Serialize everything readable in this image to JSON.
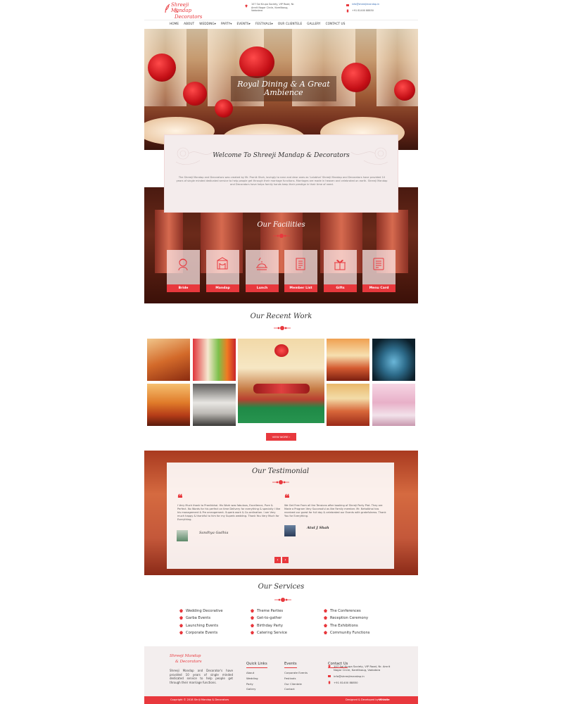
{
  "brand": {
    "name_line1": "Shreeji Mandap",
    "name_line2": "& Decorators"
  },
  "header": {
    "address": [
      "107 Sai Krupa Society, VIP Road, Nr.",
      "Amrit Nagar Circle, Karelibaug,",
      "Vadodara"
    ],
    "email": "info@shreejimandap.in",
    "phone": "+91 81400 88850"
  },
  "nav": [
    "HOME",
    "ABOUT",
    "WEDDING▾",
    "PARTY▾",
    "EVENTS▾",
    "FESTIVALS▾",
    "OUR CLIENTELE",
    "GALLERY",
    "CONTACT US"
  ],
  "hero": {
    "caption": "Royal Dining & A Great Ambience"
  },
  "welcome": {
    "title": "Welcome To Shreeji Mandap & Decorators",
    "body": "The Shreeji Mandap and Decorators was created by Mr. Pranik Shah, lovingly to near and dear ones as 'Lalubhai' Shreeji Mandap and Decorators have provided 10 years of single minded dedicated service to help people get through their marriage functions. Marriages are made in heaven and celebrated on earth. Shreeji Mandap and Decorators have helps family hands keep their prestige in their time of need."
  },
  "facilities": {
    "title": "Our Facilities",
    "items": [
      {
        "label": "Bride",
        "icon": "bride-icon"
      },
      {
        "label": "Mandap",
        "icon": "mandap-icon"
      },
      {
        "label": "Lunch",
        "icon": "lunch-icon"
      },
      {
        "label": "Member List",
        "icon": "member-list-icon"
      },
      {
        "label": "Gifts",
        "icon": "gift-icon"
      },
      {
        "label": "Menu Card",
        "icon": "menu-card-icon"
      }
    ]
  },
  "recent_work": {
    "title": "Our Recent Work",
    "button": "VIEW MORE ›"
  },
  "testimonial": {
    "title": "Our Testimonial",
    "items": [
      {
        "text": "I Very Much thank to Pranikbhai. His Work was fabulous, Excellence, Pure & Perfect. No Words for his perfect on time Delivery for everything & specially I like his management & Pre arrangement. Superb work & Co-ordination. I am Very much happy & thankful to him for my Superb wedding. Thank You Very Much for Everything.",
        "name": "Sandhya Gadhia"
      },
      {
        "text": "We Get Free From all the Tensions after booking of Shrreji Party Plot. They are Made a Program Very Successful as like Family member. Mr. Nehalbhai has received our guest for full day & celebrated our Events with gratefulness. Thank You for Everything.",
        "name": "Atul J Shah"
      }
    ],
    "prev": "‹",
    "next": "›"
  },
  "services": {
    "title": "Our Services",
    "columns": [
      [
        "Wedding Decorative",
        "Garba Events",
        "Launching Events",
        "Corporate Events"
      ],
      [
        "Theme Parties",
        "Get-to-gather",
        "Birthday Party",
        "Catering Service"
      ],
      [
        "The Conferences",
        "Reception Ceremony",
        "The Exhibitions",
        "Community Functions"
      ]
    ]
  },
  "footer": {
    "about": "Shreeji Mandap and Decorator's have provided 10 years of single minded dedicated service to help people get through their marriage functions.",
    "quick_links": {
      "title": "Quick Links",
      "items": [
        "About",
        "Wedding",
        "Party",
        "Gallery"
      ]
    },
    "events": {
      "title": "Events",
      "items": [
        "Corporate Events",
        "Festivals",
        "Our Clientele",
        "Contact"
      ]
    },
    "contact": {
      "title": "Contact Us",
      "address": "107 Sai Krupa Society, VIP Road, Nr. Amrit Nagar Circle, Karelibaug, Vadodara",
      "email": "info@shreejimandap.in",
      "phone": "+91 81400 88850"
    },
    "copyright": "Copyright © 2018 Shriji Mandap & Decorators",
    "designed_by": "Designed & Developed by",
    "developer": "-Whistle"
  },
  "colors": {
    "accent": "#e8383d",
    "card": "#f4ecec",
    "footer": "#f3eeee"
  }
}
